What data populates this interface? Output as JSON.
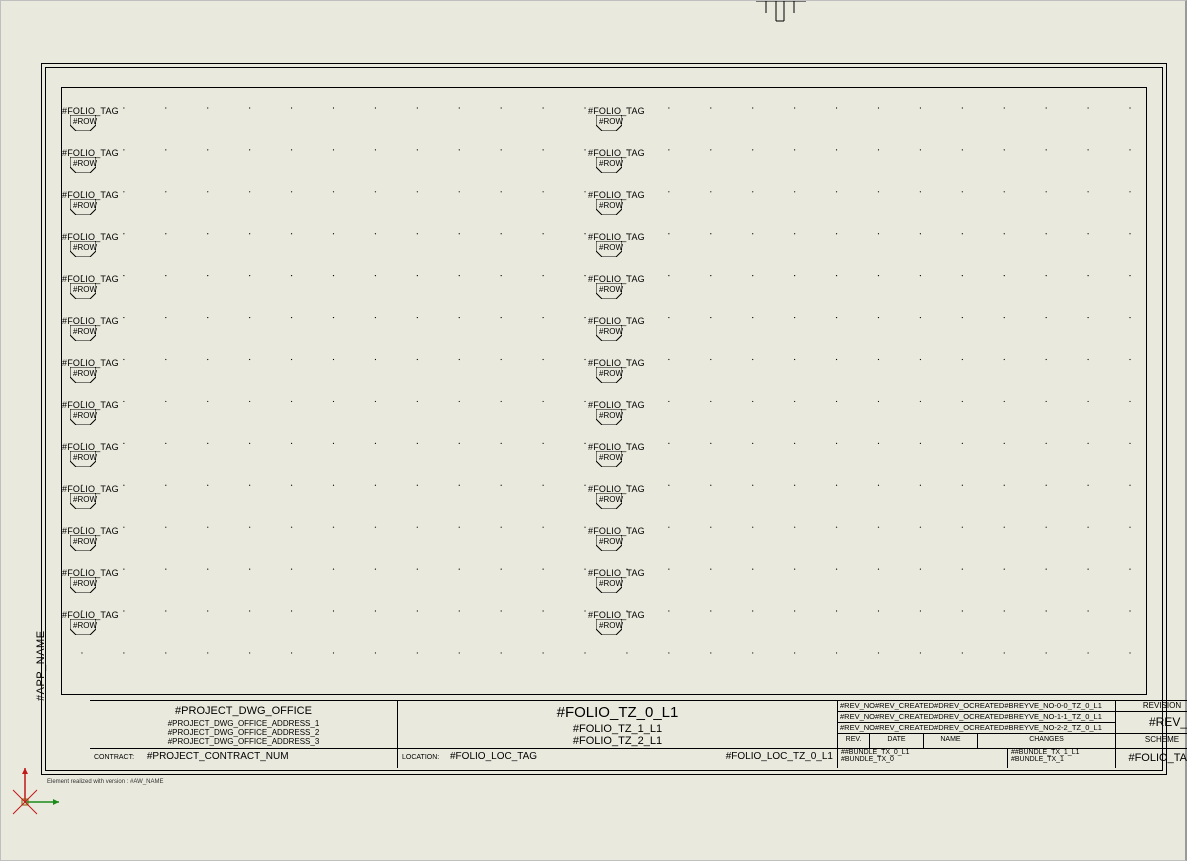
{
  "app_name_vertical": "#APP_NAME",
  "fineprint": "Element realized with version :  #AW_NAME",
  "terminal": {
    "tag_label": "#FOLIO_TAG",
    "row_label": "#ROW",
    "row_count": 13
  },
  "titleblock": {
    "office_title": "#PROJECT_DWG_OFFICE",
    "office_addr1": "#PROJECT_DWG_OFFICE_ADDRESS_1",
    "office_addr2": "#PROJECT_DWG_OFFICE_ADDRESS_2",
    "office_addr3": "#PROJECT_DWG_OFFICE_ADDRESS_3",
    "folio_l1": "#FOLIO_TZ_0_L1",
    "folio_l2": "#FOLIO_TZ_1_L1",
    "folio_l3": "#FOLIO_TZ_2_L1",
    "rev_rows": [
      "#REV_NO#REV_CREATED#DREV_OCREATED#BREYVE_NO-0-0_TZ_0_L1",
      "#REV_NO#REV_CREATED#DREV_OCREATED#BREYVE_NO-1-1_TZ_0_L1",
      "#REV_NO#REV_CREATED#DREV_OCREATED#BREYVE_NO-2-2_TZ_0_L1"
    ],
    "rev_hdr_rev": "REV.",
    "rev_hdr_date": "DATE",
    "rev_hdr_name": "NAME",
    "rev_hdr_changes": "CHANGES",
    "revision_label": "REVISION",
    "rev_no": "#REV_NO",
    "scheme_label": "SCHEME",
    "folio_tag": "#FOLIO_TAG",
    "contract_label": "CONTRACT:",
    "contract_num": "#PROJECT_CONTRACT_NUM",
    "location_label": "LOCATION:",
    "folio_loc_tag": "#FOLIO_LOC_TAG",
    "folio_loc_tz": "#FOLIO_LOC_TZ_0_L1",
    "bundle_a_top": "##BUNDLE_TX_0_L1",
    "bundle_a_bot": "#BUNDLE_TX_0",
    "bundle_b_top": "##BUNDLE_TX_1_L1",
    "bundle_b_bot": "#BUNDLE_TX_1"
  }
}
